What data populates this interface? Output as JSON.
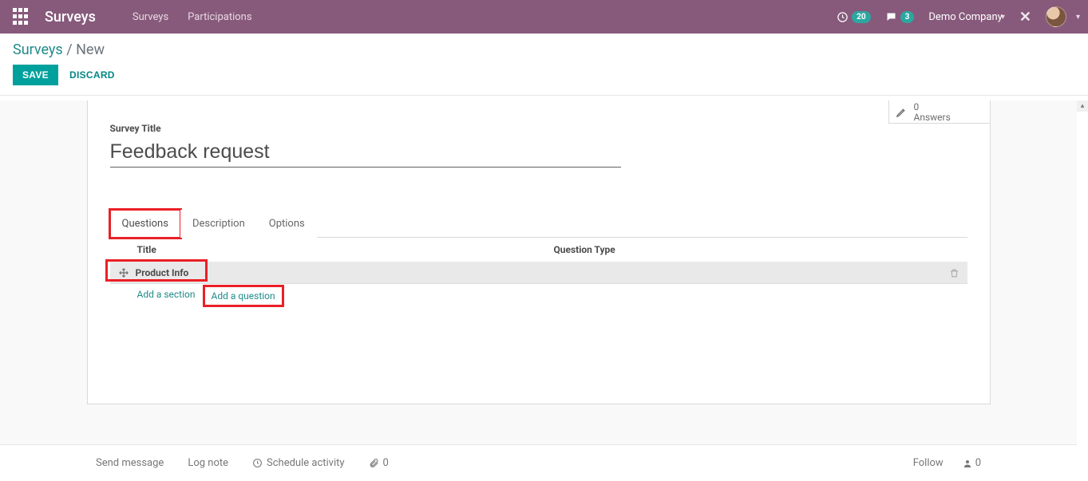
{
  "navbar": {
    "brand": "Surveys",
    "links": [
      "Surveys",
      "Participations"
    ],
    "activity_count": "20",
    "message_count": "3",
    "company": "Demo Company"
  },
  "breadcrumb": {
    "root": "Surveys",
    "current": "New"
  },
  "actions": {
    "save": "SAVE",
    "discard": "DISCARD"
  },
  "stat": {
    "count": "0",
    "label": "Answers"
  },
  "form": {
    "title_label": "Survey Title",
    "title_value": "Feedback request"
  },
  "tabs": [
    "Questions",
    "Description",
    "Options"
  ],
  "table": {
    "col_title": "Title",
    "col_qtype": "Question Type",
    "section_name": "Product Info",
    "add_section": "Add a section",
    "add_question": "Add a question"
  },
  "chatter": {
    "send": "Send message",
    "log": "Log note",
    "schedule": "Schedule activity",
    "attach_count": "0",
    "follow": "Follow",
    "followers": "0"
  }
}
